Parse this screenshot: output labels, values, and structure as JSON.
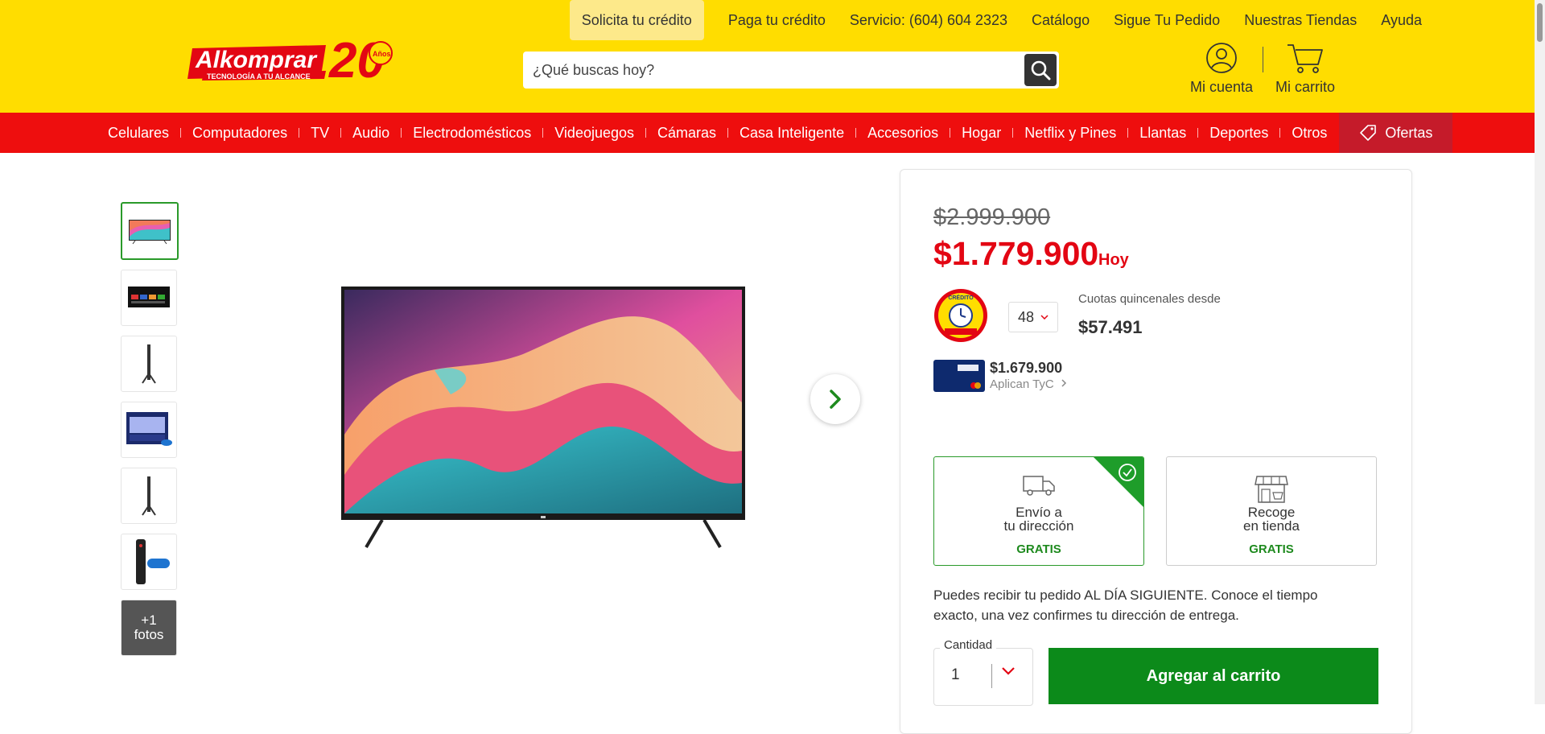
{
  "header": {
    "top_links": [
      {
        "label": "Solicita tu crédito"
      },
      {
        "label": "Paga tu crédito"
      },
      {
        "label": "Servicio: (604) 604 2323"
      },
      {
        "label": "Catálogo"
      },
      {
        "label": "Sigue Tu Pedido"
      },
      {
        "label": "Nuestras Tiendas"
      },
      {
        "label": "Ayuda"
      }
    ],
    "logo": {
      "brand": "Alkomprar",
      "tagline": "TECNOLOGÍA A TU ALCANCE",
      "anniversary_number": "20",
      "anniversary_word": "Años"
    },
    "search": {
      "placeholder": "¿Qué buscas hoy?"
    },
    "account_label": "Mi cuenta",
    "cart_label": "Mi carrito"
  },
  "nav": {
    "items": [
      "Celulares",
      "Computadores",
      "TV",
      "Audio",
      "Electrodomésticos",
      "Videojuegos",
      "Cámaras",
      "Casa Inteligente",
      "Accesorios",
      "Hogar",
      "Netflix y Pines",
      "Llantas",
      "Deportes",
      "Otros"
    ],
    "offers_label": "Ofertas"
  },
  "gallery": {
    "more_photos": {
      "line1": "+1",
      "line2": "fotos"
    }
  },
  "product": {
    "old_price": "$2.999.900",
    "price": "$1.779.900",
    "price_suffix": "Hoy",
    "installments": {
      "selected": "48",
      "label": "Cuotas quincenales desde",
      "value": "$57.491",
      "badge_text": "CRÉDITO"
    },
    "card_offer": {
      "price": "$1.679.900",
      "terms": "Aplican TyC"
    },
    "shipping": [
      {
        "line1": "Envío a",
        "line2": "tu dirección",
        "free": "GRATIS",
        "selected": true
      },
      {
        "line1": "Recoge",
        "line2": "en tienda",
        "free": "GRATIS",
        "selected": false
      }
    ],
    "delivery_text": "Puedes recibir tu pedido AL DÍA SIGUIENTE. Conoce el tiempo exacto, una vez confirmes tu dirección de entrega.",
    "quantity": {
      "label": "Cantidad",
      "value": "1"
    },
    "add_to_cart": "Agregar al carrito"
  },
  "colors": {
    "header_yellow": "#ffdd00",
    "nav_red": "#ee0e0e",
    "price_red": "#e30613",
    "cta_green": "#0c8a1a"
  }
}
